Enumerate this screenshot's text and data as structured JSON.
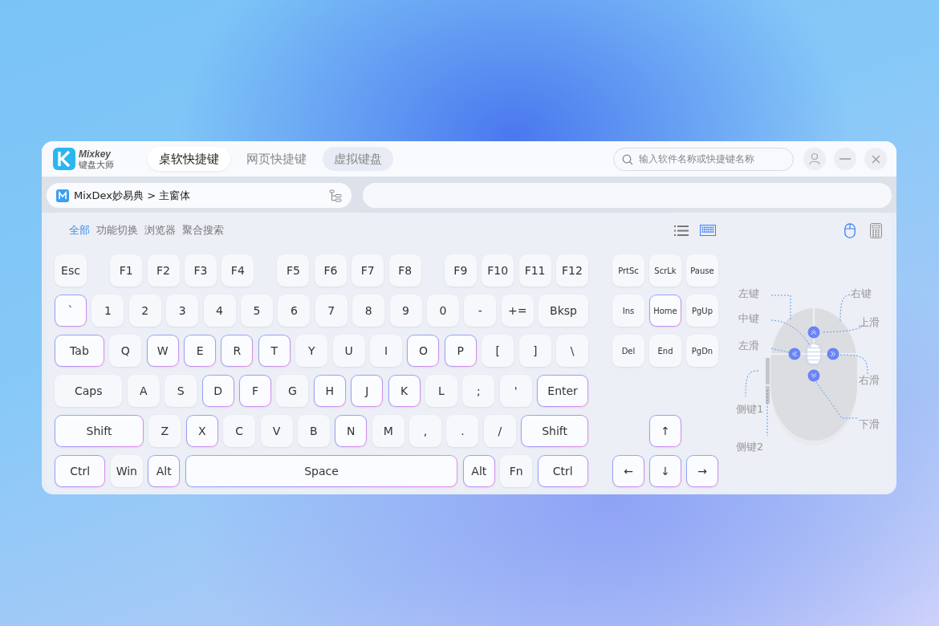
{
  "app": {
    "logo_name": "Mixkey",
    "logo_subtitle": "键盘大师"
  },
  "tabs": [
    {
      "label": "桌软快捷键",
      "selected": true
    },
    {
      "label": "网页快捷键",
      "selected": false
    },
    {
      "label": "虚拟键盘",
      "selected": false
    }
  ],
  "search": {
    "placeholder": "输入软件名称或快捷键名称"
  },
  "breadcrumb": {
    "text": "MixDex妙易典 > 主窗体"
  },
  "filters": [
    {
      "label": "全部",
      "selected": true
    },
    {
      "label": "功能切换",
      "selected": false
    },
    {
      "label": "浏览器",
      "selected": false
    },
    {
      "label": "聚合搜索",
      "selected": false
    }
  ],
  "view_toggles": [
    {
      "kind": "list",
      "selected": false
    },
    {
      "kind": "keyboard",
      "selected": true
    }
  ],
  "device_toggles": [
    {
      "kind": "mouse",
      "selected": true
    },
    {
      "kind": "keypad",
      "selected": false
    }
  ],
  "function_row": [
    [
      {
        "label": "Esc",
        "highlighted": false
      }
    ],
    [
      {
        "label": "F1",
        "highlighted": false
      },
      {
        "label": "F2",
        "highlighted": false
      },
      {
        "label": "F3",
        "highlighted": false
      },
      {
        "label": "F4",
        "highlighted": false
      }
    ],
    [
      {
        "label": "F5",
        "highlighted": false
      },
      {
        "label": "F6",
        "highlighted": false
      },
      {
        "label": "F7",
        "highlighted": false
      },
      {
        "label": "F8",
        "highlighted": false
      }
    ],
    [
      {
        "label": "F9",
        "highlighted": false
      },
      {
        "label": "F10",
        "highlighted": false
      },
      {
        "label": "F11",
        "highlighted": false
      },
      {
        "label": "F12",
        "highlighted": false
      }
    ]
  ],
  "main_rows": [
    [
      {
        "label": "`",
        "kind": "key",
        "highlighted": true
      },
      {
        "label": "1",
        "kind": "key",
        "highlighted": false
      },
      {
        "label": "2",
        "kind": "key",
        "highlighted": false
      },
      {
        "label": "3",
        "kind": "key",
        "highlighted": false
      },
      {
        "label": "4",
        "kind": "key",
        "highlighted": false
      },
      {
        "label": "5",
        "kind": "key",
        "highlighted": false
      },
      {
        "label": "6",
        "kind": "key",
        "highlighted": false
      },
      {
        "label": "7",
        "kind": "key",
        "highlighted": false
      },
      {
        "label": "8",
        "kind": "key",
        "highlighted": false
      },
      {
        "label": "9",
        "kind": "key",
        "highlighted": false
      },
      {
        "label": "0",
        "kind": "key",
        "highlighted": false
      },
      {
        "label": "-",
        "kind": "key",
        "highlighted": false
      },
      {
        "label": "+=",
        "kind": "key",
        "highlighted": false
      },
      {
        "label": "Bksp",
        "kind": "wide",
        "highlighted": false
      }
    ],
    [
      {
        "label": "Tab",
        "kind": "wide",
        "highlighted": true
      },
      {
        "label": "Q",
        "kind": "key",
        "highlighted": false
      },
      {
        "label": "W",
        "kind": "key",
        "highlighted": true
      },
      {
        "label": "E",
        "kind": "key",
        "highlighted": true
      },
      {
        "label": "R",
        "kind": "key",
        "highlighted": true
      },
      {
        "label": "T",
        "kind": "key",
        "highlighted": true
      },
      {
        "label": "Y",
        "kind": "key",
        "highlighted": false
      },
      {
        "label": "U",
        "kind": "key",
        "highlighted": false
      },
      {
        "label": "I",
        "kind": "key",
        "highlighted": false
      },
      {
        "label": "O",
        "kind": "key",
        "highlighted": true
      },
      {
        "label": "P",
        "kind": "key",
        "highlighted": true
      },
      {
        "label": "[",
        "kind": "key",
        "highlighted": false
      },
      {
        "label": "]",
        "kind": "key",
        "highlighted": false
      },
      {
        "label": "\\",
        "kind": "key",
        "highlighted": false
      }
    ],
    [
      {
        "label": "Caps",
        "kind": "wider",
        "highlighted": false
      },
      {
        "label": "A",
        "kind": "key",
        "highlighted": false
      },
      {
        "label": "S",
        "kind": "key",
        "highlighted": false
      },
      {
        "label": "D",
        "kind": "key",
        "highlighted": true
      },
      {
        "label": "F",
        "kind": "key",
        "highlighted": true
      },
      {
        "label": "G",
        "kind": "key",
        "highlighted": false
      },
      {
        "label": "H",
        "kind": "key",
        "highlighted": true
      },
      {
        "label": "J",
        "kind": "key",
        "highlighted": true
      },
      {
        "label": "K",
        "kind": "key",
        "highlighted": true
      },
      {
        "label": "L",
        "kind": "key",
        "highlighted": false
      },
      {
        "label": ";",
        "kind": "key",
        "highlighted": false
      },
      {
        "label": "'",
        "kind": "key",
        "highlighted": false
      },
      {
        "label": "Enter",
        "kind": "wide",
        "highlighted": true
      }
    ],
    [
      {
        "label": "Shift",
        "kind": "wider",
        "highlighted": true
      },
      {
        "label": "Z",
        "kind": "key",
        "highlighted": false
      },
      {
        "label": "X",
        "kind": "key",
        "highlighted": true
      },
      {
        "label": "C",
        "kind": "key",
        "highlighted": false
      },
      {
        "label": "V",
        "kind": "key",
        "highlighted": false
      },
      {
        "label": "B",
        "kind": "key",
        "highlighted": false
      },
      {
        "label": "N",
        "kind": "key",
        "highlighted": true
      },
      {
        "label": "M",
        "kind": "key",
        "highlighted": false
      },
      {
        "label": ",",
        "kind": "key",
        "highlighted": false
      },
      {
        "label": ".",
        "kind": "key",
        "highlighted": false
      },
      {
        "label": "/",
        "kind": "key",
        "highlighted": false
      },
      {
        "label": "Shift",
        "kind": "wide",
        "highlighted": true
      }
    ],
    [
      {
        "label": "Ctrl",
        "kind": "wide",
        "highlighted": true
      },
      {
        "label": "Win",
        "kind": "key",
        "highlighted": false
      },
      {
        "label": "Alt",
        "kind": "key",
        "highlighted": true
      },
      {
        "label": "Space",
        "kind": "space",
        "highlighted": true
      },
      {
        "label": "Alt",
        "kind": "key",
        "highlighted": true
      },
      {
        "label": "Fn",
        "kind": "key",
        "highlighted": false
      },
      {
        "label": "Ctrl",
        "kind": "wide",
        "highlighted": true
      }
    ]
  ],
  "nav_rows": [
    [
      {
        "label": "PrtSc",
        "highlighted": false
      },
      {
        "label": "ScrLk",
        "highlighted": false
      },
      {
        "label": "Pause",
        "highlighted": false
      }
    ],
    [
      {
        "label": "Ins",
        "highlighted": false
      },
      {
        "label": "Home",
        "highlighted": true
      },
      {
        "label": "PgUp",
        "highlighted": false
      }
    ],
    [
      {
        "label": "Del",
        "highlighted": false
      },
      {
        "label": "End",
        "highlighted": false
      },
      {
        "label": "PgDn",
        "highlighted": false
      }
    ]
  ],
  "arrow_rows": [
    [
      {
        "label": "↑",
        "highlighted": true
      }
    ],
    [
      {
        "label": "←",
        "highlighted": true
      },
      {
        "label": "↓",
        "highlighted": true
      },
      {
        "label": "→",
        "highlighted": true
      }
    ]
  ],
  "mouse_labels": [
    "左键",
    "中键",
    "左滑",
    "侧键1",
    "侧键2",
    "右键",
    "上滑",
    "右滑",
    "下滑"
  ]
}
